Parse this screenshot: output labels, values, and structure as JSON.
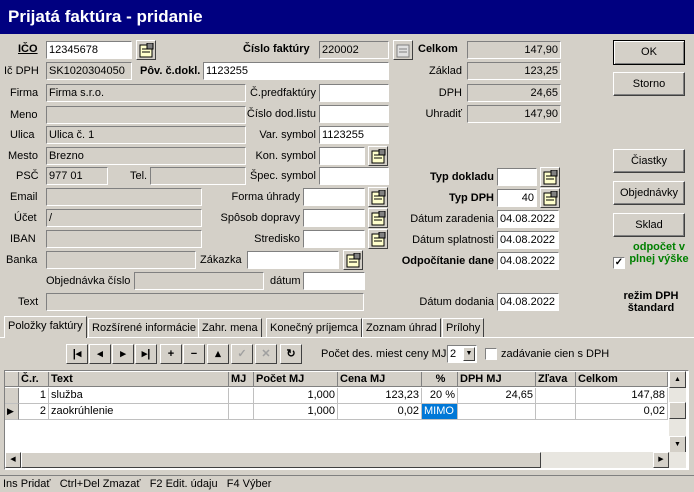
{
  "title": "Prijatá faktúra  - pridanie",
  "left": {
    "ico_label": "IČO",
    "ico": "12345678",
    "icdph_label": "Ič DPH",
    "icdph": "SK1020304050",
    "firma_label": "Firma",
    "firma": "Firma s.r.o.",
    "meno_label": "Meno",
    "meno": "",
    "ulica_label": "Ulica",
    "ulica": "Ulica č. 1",
    "mesto_label": "Mesto",
    "mesto": "Brezno",
    "psc_label": "PSČ",
    "psc": "977 01",
    "tel_label": "Tel.",
    "tel": "",
    "email_label": "Email",
    "email": "",
    "ucet_label": "Účet",
    "ucet": "/",
    "iban_label": "IBAN",
    "iban": "",
    "banka_label": "Banka",
    "banka": "",
    "objednavka_label": "Objednávka číslo",
    "objednavka": "",
    "text_label": "Text",
    "text": ""
  },
  "middle": {
    "cislo_faktury_label": "Číslo faktúry",
    "cislo_faktury": "220002",
    "pov_cdokl_label": "Pôv. č.dokl.",
    "pov_cdokl": "1123255",
    "predfaktury_label": "Č.predfaktúry",
    "predfaktury": "",
    "dodlistu_label": "Číslo dod.listu",
    "dodlistu": "",
    "var_symbol_label": "Var. symbol",
    "var_symbol": "1123255",
    "kon_symbol_label": "Kon. symbol",
    "kon_symbol": "",
    "spec_symbol_label": "Špec. symbol",
    "spec_symbol": "",
    "forma_uhrady_label": "Forma úhrady",
    "forma_uhrady": "",
    "sposob_dopravy_label": "Spôsob dopravy",
    "sposob_dopravy": "",
    "stredisko_label": "Stredisko",
    "stredisko": "",
    "zakazka_label": "Zákazka",
    "zakazka": "",
    "datum_label": "dátum",
    "datum": ""
  },
  "totals": {
    "celkom_label": "Celkom",
    "celkom": "147,90",
    "zaklad_label": "Základ",
    "zaklad": "123,25",
    "dph_label": "DPH",
    "dph": "24,65",
    "uhradit_label": "Uhradiť",
    "uhradit": "147,90"
  },
  "doc": {
    "typ_dokladu_label": "Typ dokladu",
    "typ_dokladu": "",
    "typ_dph_label": "Typ DPH",
    "typ_dph": "40",
    "datum_zaradenia_label": "Dátum zaradenia",
    "datum_zaradenia": "04.08.2022",
    "datum_splatnosti_label": "Dátum splatnosti",
    "datum_splatnosti": "04.08.2022",
    "odpocitanie_label": "Odpočítanie dane",
    "odpocitanie": "04.08.2022",
    "datum_dodania_label": "Dátum dodania",
    "datum_dodania": "04.08.2022"
  },
  "buttons": {
    "ok": "OK",
    "storno": "Storno",
    "ciastky": "Čiastky",
    "objednavky": "Objednávky",
    "sklad": "Sklad"
  },
  "odpocet": "odpočet v plnej výške",
  "odpocet_checked": true,
  "rezim": "režim DPH štandard",
  "tabs": [
    "Položky faktúry",
    "Rozšírené informácie",
    "Zahr. mena",
    "Konečný príjemca",
    "Zoznam úhrad",
    "Prílohy"
  ],
  "toolbar": {
    "pocet_label": "Počet des. miest ceny MJ",
    "pocet_value": "2",
    "zadavanie_label": "zadávanie cien s DPH",
    "zadavanie_checked": false,
    "icons": [
      "first-icon",
      "prev-icon",
      "next-icon",
      "last-icon",
      "plus-icon",
      "minus-icon",
      "up-icon",
      "check-icon",
      "cancel-icon",
      "refresh-icon"
    ]
  },
  "grid": {
    "headers": [
      "Č.r.",
      "Text",
      "MJ",
      "Počet MJ",
      "Cena MJ",
      "%",
      "DPH MJ",
      "Zľava",
      "Celkom"
    ],
    "rows": [
      [
        "1",
        "služba",
        "",
        "1,000",
        "123,23",
        "20 %",
        "24,65",
        "",
        "147,88"
      ],
      [
        "2",
        "zaokrúhlenie",
        "",
        "1,000",
        "0,02",
        "MIMO",
        "",
        "",
        "0,02"
      ]
    ]
  },
  "status": "Ins Pridať   Ctrl+Del Zmazať   F2 Edit. údaju   F4 Výber",
  "colors": {
    "titlebar": "#000080",
    "odpocet": "#008000",
    "selected_cell": "#0078d7"
  }
}
